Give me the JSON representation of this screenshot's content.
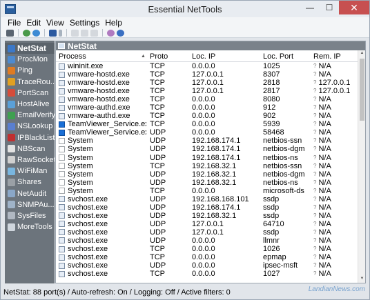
{
  "window": {
    "title": "Essential NetTools"
  },
  "menu": [
    "File",
    "Edit",
    "View",
    "Settings",
    "Help"
  ],
  "sidebar": [
    {
      "label": "NetStat",
      "color": "#3c78c8",
      "active": true
    },
    {
      "label": "ProcMon",
      "color": "#4d8ad0"
    },
    {
      "label": "Ping",
      "color": "#e07b22"
    },
    {
      "label": "TraceRou...",
      "color": "#e0a022"
    },
    {
      "label": "PortScan",
      "color": "#d54c3a"
    },
    {
      "label": "HostAlive",
      "color": "#5aa0d8"
    },
    {
      "label": "EmailVerify",
      "color": "#3fa050"
    },
    {
      "label": "NSLookup",
      "color": "#5a7fd0"
    },
    {
      "label": "IPBlackList",
      "color": "#c03030"
    },
    {
      "label": "NBScan",
      "color": "#e3e3e3"
    },
    {
      "label": "RawSocket",
      "color": "#d0d0d0"
    },
    {
      "label": "WiFiMan",
      "color": "#79b6e0"
    },
    {
      "label": "Shares",
      "color": "#9aa0a6"
    },
    {
      "label": "NetAudit",
      "color": "#8aa7c8"
    },
    {
      "label": "SNMPAu...",
      "color": "#9fb3c8"
    },
    {
      "label": "SysFiles",
      "color": "#b0b8c2"
    },
    {
      "label": "MoreTools",
      "color": "#cfd6dd"
    }
  ],
  "panel": {
    "title": "NetStat"
  },
  "columns": {
    "process": "Process",
    "proto": "Proto",
    "local_ip": "Loc. IP",
    "local_port": "Loc. Port",
    "remote_ip": "Rem. IP"
  },
  "rows": [
    {
      "process": "wininit.exe",
      "proto": "TCP",
      "local_ip": "0.0.0.0",
      "local_port": "1025",
      "remote_ip": "N/A",
      "icon": "app"
    },
    {
      "process": "vmware-hostd.exe",
      "proto": "TCP",
      "local_ip": "127.0.0.1",
      "local_port": "8307",
      "remote_ip": "N/A",
      "icon": "app"
    },
    {
      "process": "vmware-hostd.exe",
      "proto": "TCP",
      "local_ip": "127.0.0.1",
      "local_port": "2818",
      "remote_ip": "127.0.0.1",
      "icon": "app"
    },
    {
      "process": "vmware-hostd.exe",
      "proto": "TCP",
      "local_ip": "127.0.0.1",
      "local_port": "2817",
      "remote_ip": "127.0.0.1",
      "icon": "app"
    },
    {
      "process": "vmware-hostd.exe",
      "proto": "TCP",
      "local_ip": "0.0.0.0",
      "local_port": "8080",
      "remote_ip": "N/A",
      "icon": "app"
    },
    {
      "process": "vmware-authd.exe",
      "proto": "TCP",
      "local_ip": "0.0.0.0",
      "local_port": "912",
      "remote_ip": "N/A",
      "icon": "app"
    },
    {
      "process": "vmware-authd.exe",
      "proto": "TCP",
      "local_ip": "0.0.0.0",
      "local_port": "902",
      "remote_ip": "N/A",
      "icon": "app"
    },
    {
      "process": "TeamViewer_Service.exe",
      "proto": "TCP",
      "local_ip": "0.0.0.0",
      "local_port": "5939",
      "remote_ip": "N/A",
      "icon": "tv"
    },
    {
      "process": "TeamViewer_Service.exe",
      "proto": "UDP",
      "local_ip": "0.0.0.0",
      "local_port": "58468",
      "remote_ip": "N/A",
      "icon": "tv"
    },
    {
      "process": "System",
      "proto": "UDP",
      "local_ip": "192.168.174.1",
      "local_port": "netbios-ssn",
      "remote_ip": "N/A",
      "icon": "sys"
    },
    {
      "process": "System",
      "proto": "UDP",
      "local_ip": "192.168.174.1",
      "local_port": "netbios-dgm",
      "remote_ip": "N/A",
      "icon": "sys"
    },
    {
      "process": "System",
      "proto": "UDP",
      "local_ip": "192.168.174.1",
      "local_port": "netbios-ns",
      "remote_ip": "N/A",
      "icon": "sys"
    },
    {
      "process": "System",
      "proto": "TCP",
      "local_ip": "192.168.32.1",
      "local_port": "netbios-ssn",
      "remote_ip": "N/A",
      "icon": "sys"
    },
    {
      "process": "System",
      "proto": "UDP",
      "local_ip": "192.168.32.1",
      "local_port": "netbios-dgm",
      "remote_ip": "N/A",
      "icon": "sys"
    },
    {
      "process": "System",
      "proto": "UDP",
      "local_ip": "192.168.32.1",
      "local_port": "netbios-ns",
      "remote_ip": "N/A",
      "icon": "sys"
    },
    {
      "process": "System",
      "proto": "TCP",
      "local_ip": "0.0.0.0",
      "local_port": "microsoft-ds",
      "remote_ip": "N/A",
      "icon": "sys"
    },
    {
      "process": "svchost.exe",
      "proto": "UDP",
      "local_ip": "192.168.168.101",
      "local_port": "ssdp",
      "remote_ip": "N/A",
      "icon": "app"
    },
    {
      "process": "svchost.exe",
      "proto": "UDP",
      "local_ip": "192.168.174.1",
      "local_port": "ssdp",
      "remote_ip": "N/A",
      "icon": "app"
    },
    {
      "process": "svchost.exe",
      "proto": "UDP",
      "local_ip": "192.168.32.1",
      "local_port": "ssdp",
      "remote_ip": "N/A",
      "icon": "app"
    },
    {
      "process": "svchost.exe",
      "proto": "UDP",
      "local_ip": "127.0.0.1",
      "local_port": "64710",
      "remote_ip": "N/A",
      "icon": "app"
    },
    {
      "process": "svchost.exe",
      "proto": "UDP",
      "local_ip": "127.0.0.1",
      "local_port": "ssdp",
      "remote_ip": "N/A",
      "icon": "app"
    },
    {
      "process": "svchost.exe",
      "proto": "UDP",
      "local_ip": "0.0.0.0",
      "local_port": "llmnr",
      "remote_ip": "N/A",
      "icon": "app"
    },
    {
      "process": "svchost.exe",
      "proto": "TCP",
      "local_ip": "0.0.0.0",
      "local_port": "1026",
      "remote_ip": "N/A",
      "icon": "app"
    },
    {
      "process": "svchost.exe",
      "proto": "TCP",
      "local_ip": "0.0.0.0",
      "local_port": "epmap",
      "remote_ip": "N/A",
      "icon": "app"
    },
    {
      "process": "svchost.exe",
      "proto": "UDP",
      "local_ip": "0.0.0.0",
      "local_port": "ipsec-msft",
      "remote_ip": "N/A",
      "icon": "app"
    },
    {
      "process": "svchost.exe",
      "proto": "TCP",
      "local_ip": "0.0.0.0",
      "local_port": "1027",
      "remote_ip": "N/A",
      "icon": "app"
    }
  ],
  "status": "NetStat: 88 port(s) / Auto-refresh: On / Logging: Off / Active filters: 0",
  "watermark": "LandianNews.com"
}
